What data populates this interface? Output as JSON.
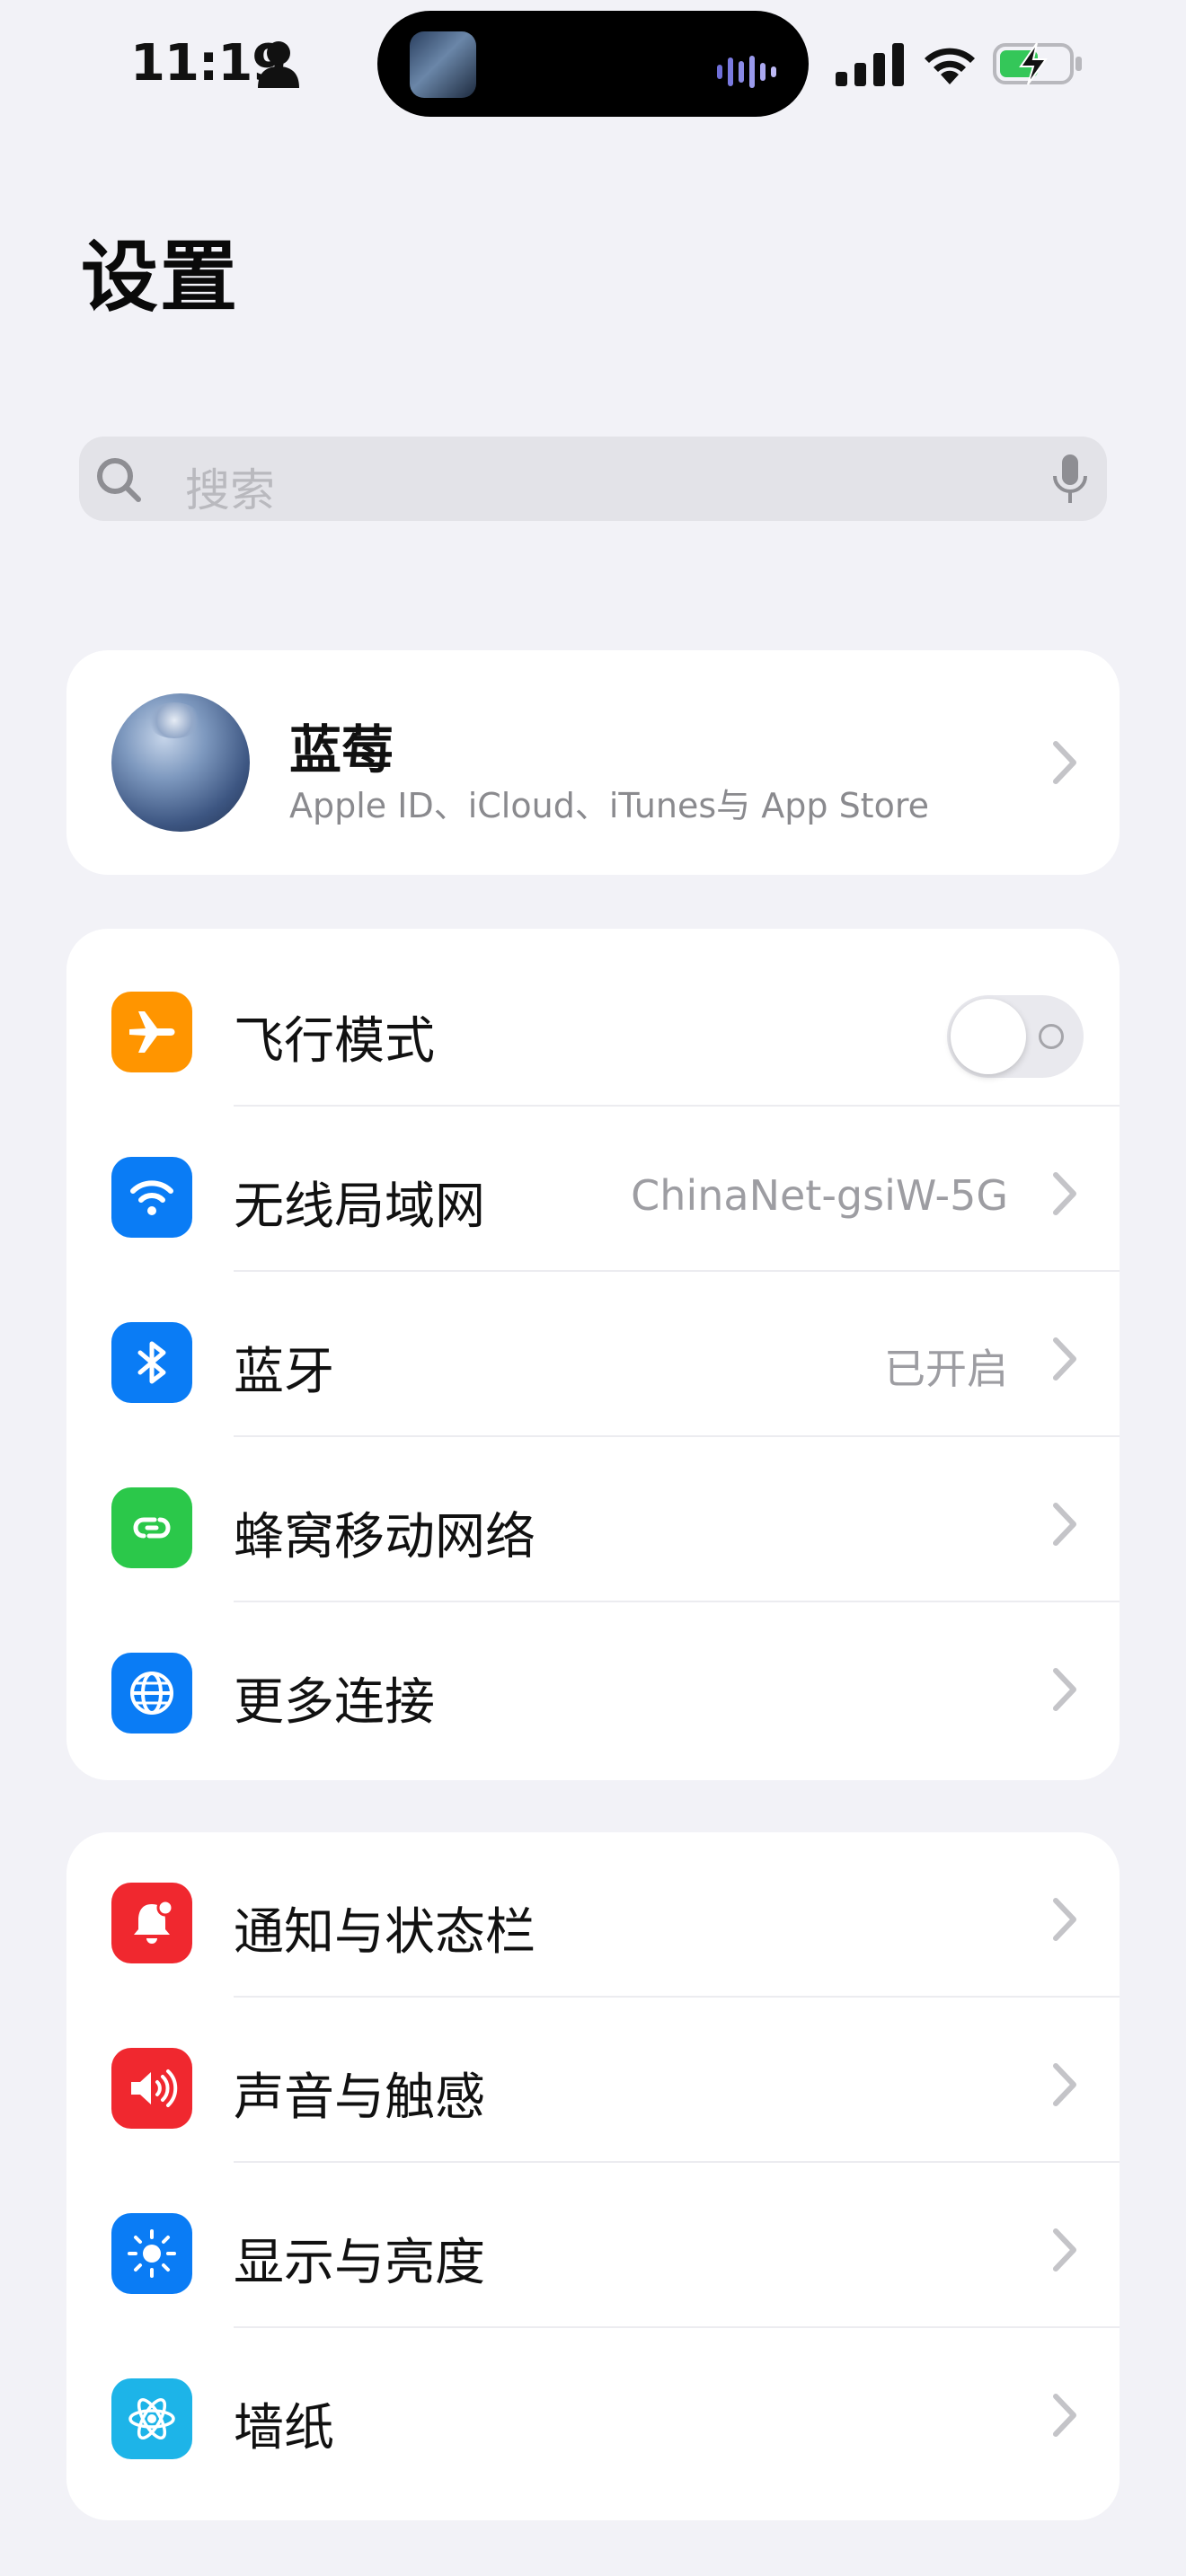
{
  "status_bar": {
    "time": "11:19"
  },
  "title": "设置",
  "search": {
    "placeholder": "搜索"
  },
  "profile": {
    "name": "蓝莓",
    "subtitle": "Apple ID、iCloud、iTunes与 App Store"
  },
  "network": {
    "items": [
      {
        "label": "飞行模式",
        "icon": "airplane-icon",
        "color": "#ff9500",
        "toggle": false
      },
      {
        "label": "无线局域网",
        "icon": "wifi-icon",
        "color": "#0a7cf5",
        "value": "ChinaNet-gsiW-5G"
      },
      {
        "label": "蓝牙",
        "icon": "bluetooth-icon",
        "color": "#0a7cf5",
        "value": "已开启"
      },
      {
        "label": "蜂窝移动网络",
        "icon": "cellular-icon",
        "color": "#2bc84a",
        "value": ""
      },
      {
        "label": "更多连接",
        "icon": "globe-icon",
        "color": "#0a7cf5",
        "value": ""
      }
    ]
  },
  "system": {
    "items": [
      {
        "label": "通知与状态栏",
        "icon": "bell-icon",
        "color": "#f0282f"
      },
      {
        "label": "声音与触感",
        "icon": "speaker-icon",
        "color": "#f0282f"
      },
      {
        "label": "显示与亮度",
        "icon": "sun-icon",
        "color": "#0a7cf5"
      },
      {
        "label": "墙纸",
        "icon": "atom-icon",
        "color": "#1db4e8"
      }
    ]
  },
  "colors": {
    "background": "#f2f2f7",
    "card": "#ffffff",
    "secondary_text": "#9d9da2"
  }
}
